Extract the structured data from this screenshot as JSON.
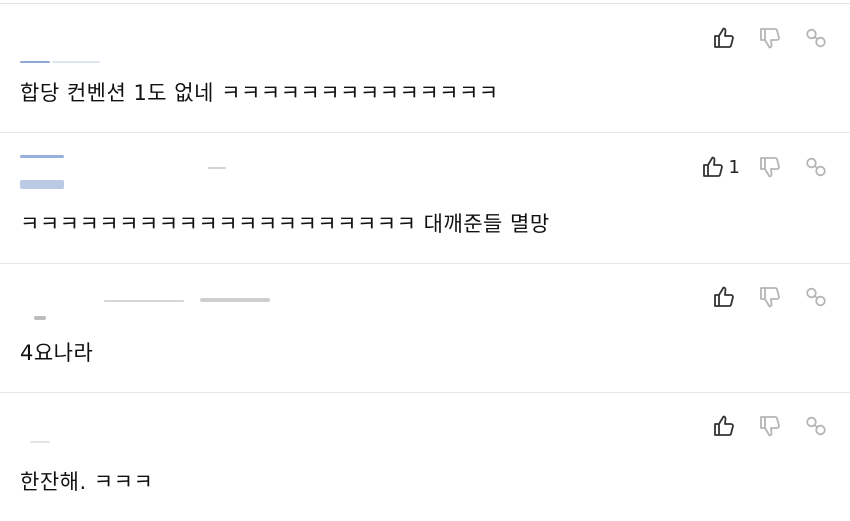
{
  "colors": {
    "text": "#111111",
    "icon_active": "#333333",
    "icon_muted": "#b5b5b5",
    "divider": "#e6e6e6"
  },
  "comments": [
    {
      "text": "합당 컨벤션 1도 없네 ㅋㅋㅋㅋㅋㅋㅋㅋㅋㅋㅋㅋㅋㅋ",
      "likes": ""
    },
    {
      "text": "ㅋㅋㅋㅋㅋㅋㅋㅋㅋㅋㅋㅋㅋㅋㅋㅋㅋㅋㅋㅋ 대깨준들 멸망",
      "likes": "1"
    },
    {
      "text": "4요나라",
      "likes": ""
    },
    {
      "text": "한잔해. ㅋㅋㅋ",
      "likes": ""
    }
  ],
  "icons": {
    "like": "thumbs-up-icon",
    "dislike": "thumbs-down-icon",
    "share": "link-icon"
  }
}
